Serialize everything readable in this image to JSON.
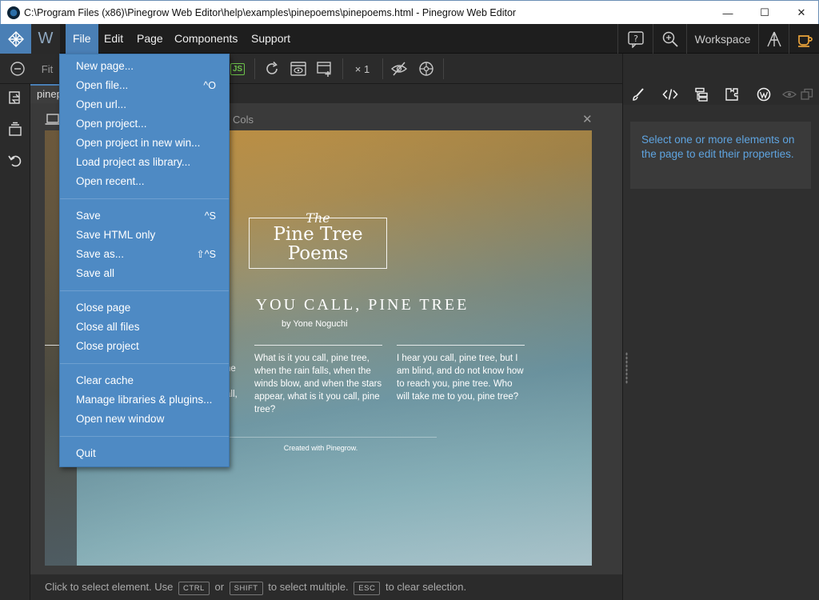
{
  "window": {
    "title": "C:\\Program Files (x86)\\Pinegrow Web Editor\\help\\examples\\pinepoems\\pinepoems.html - Pinegrow Web Editor",
    "min_glyph": "—",
    "max_glyph": "☐",
    "close_glyph": "✕"
  },
  "menubar": {
    "w_label": "W",
    "items": [
      "File",
      "Edit",
      "Page",
      "Components",
      "Support"
    ],
    "workspace_label": "Workspace"
  },
  "toolbar": {
    "fit_label": "Fit",
    "js_label": "JS",
    "zoom_label": "× 1"
  },
  "page_tab": {
    "label": "pinep"
  },
  "devbar": {
    "cols_label": "Cols",
    "close_glyph": "✕"
  },
  "file_menu": {
    "groups": [
      [
        {
          "label": "New page...",
          "shortcut": ""
        },
        {
          "label": "Open file...",
          "shortcut": "^O"
        },
        {
          "label": "Open url...",
          "shortcut": ""
        },
        {
          "label": "Open project...",
          "shortcut": ""
        },
        {
          "label": "Open project in new win...",
          "shortcut": ""
        },
        {
          "label": "Load project as library...",
          "shortcut": ""
        },
        {
          "label": "Open recent...",
          "shortcut": ""
        }
      ],
      [
        {
          "label": "Save",
          "shortcut": "^S"
        },
        {
          "label": "Save HTML only",
          "shortcut": ""
        },
        {
          "label": "Save as...",
          "shortcut": "⇧^S"
        },
        {
          "label": "Save all",
          "shortcut": ""
        }
      ],
      [
        {
          "label": "Close page",
          "shortcut": ""
        },
        {
          "label": "Close all files",
          "shortcut": ""
        },
        {
          "label": "Close project",
          "shortcut": ""
        }
      ],
      [
        {
          "label": "Clear cache",
          "shortcut": ""
        },
        {
          "label": "Manage libraries & plugins...",
          "shortcut": ""
        },
        {
          "label": "Open new window",
          "shortcut": ""
        }
      ],
      [
        {
          "label": "Quit",
          "shortcut": ""
        }
      ]
    ]
  },
  "preview": {
    "logo_the": "The",
    "logo_line1": "Pine Tree",
    "logo_line2": "Poems",
    "title": "YOU CALL, PINE TREE",
    "author": "by Yone Noguchi",
    "col2": "What is it you call, pine tree, when the rain falls, when the winds blow, and when the stars appear, what is it you call, pine tree?",
    "col3": "I hear you call, pine tree, but I am blind, and do not know how to reach you, pine tree. Who will take me to you, pine tree?",
    "partial1": "he",
    "partial2": "all,",
    "footer": "Created with Pinegrow."
  },
  "properties_panel": {
    "message": "Select one or more elements on the page to edit their properties."
  },
  "statusbar": {
    "text1": "Click to select element. Use",
    "key1": "CTRL",
    "or": "or",
    "key2": "SHIFT",
    "text2": "to select multiple.",
    "key3": "ESC",
    "text3": "to clear selection."
  },
  "colors": {
    "accent": "#4a7fb5",
    "menu_bg": "#4e8ac4",
    "panel_link": "#5fa4e0",
    "workspace_cup": "#e8a23a"
  }
}
